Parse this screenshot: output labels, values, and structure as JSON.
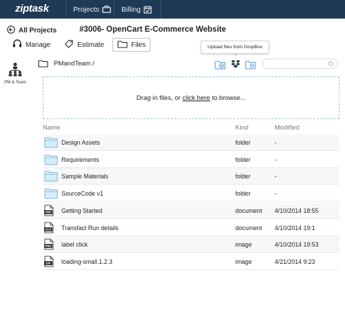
{
  "app": {
    "logo": "ziptask"
  },
  "topnav": {
    "items": [
      {
        "label": "Projects",
        "icon": "projects-icon"
      },
      {
        "label": "Billing",
        "icon": "calendar-icon"
      }
    ]
  },
  "header": {
    "back_label": "All Projects",
    "project_title": "#3006- OpenCart E-Commerce Website",
    "tabs": [
      {
        "label": "Manage",
        "icon": "headset-icon"
      },
      {
        "label": "Estimate",
        "icon": "tag-icon"
      },
      {
        "label": "Files",
        "icon": "folder-icon",
        "active": true
      }
    ]
  },
  "tooltip": {
    "text": "Upload files from DropBox"
  },
  "sidebar": {
    "pm_team_label": "PM & Team"
  },
  "path": {
    "text": "PMandTeam /"
  },
  "toolbar": {
    "tools": [
      "new-folder-icon",
      "dropbox-icon",
      "folder-settings-icon"
    ]
  },
  "dropzone": {
    "prefix": "Drag in files, or ",
    "link": "click here",
    "suffix": " to browse..."
  },
  "table": {
    "columns": [
      "Name",
      "Kind",
      "Modified"
    ],
    "rows": [
      {
        "name": "Design Assets",
        "kind": "folder",
        "modified": "-",
        "icon": "folder-icon"
      },
      {
        "name": "Requirements",
        "kind": "folder",
        "modified": "-",
        "icon": "folder-icon"
      },
      {
        "name": "Sample Materials",
        "kind": "folder",
        "modified": "-",
        "icon": "folder-icon"
      },
      {
        "name": "SourceCode v1",
        "kind": "folder",
        "modified": "-",
        "icon": "folder-icon"
      },
      {
        "name": "Getting Started",
        "kind": "document",
        "modified": "4/10/2014 18:55",
        "icon": "pdf-file-icon",
        "badge": "PDF"
      },
      {
        "name": "Transfact Run details",
        "kind": "document",
        "modified": "4/10/2014 19:1",
        "icon": "xls-file-icon",
        "badge": "XLS"
      },
      {
        "name": "label click",
        "kind": "image",
        "modified": "4/10/2014 19:53",
        "icon": "png-file-icon",
        "badge": "PNG"
      },
      {
        "name": "loading-small.1.2.3",
        "kind": "image",
        "modified": "4/21/2014 9:23",
        "icon": "gif-file-icon",
        "badge": "GIF"
      }
    ]
  },
  "colors": {
    "nav_bg": "#1f3a55",
    "folder_blue": "#7fb6dd",
    "dropzone_border": "#9cc7e4"
  }
}
